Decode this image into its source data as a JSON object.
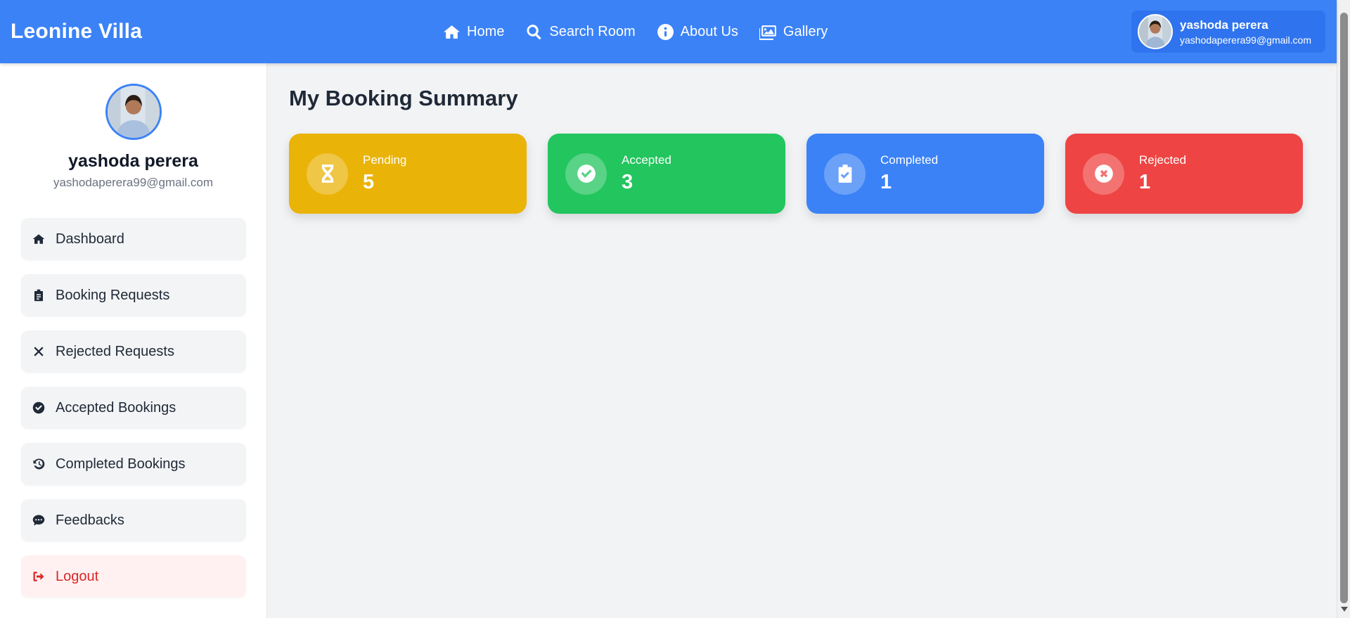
{
  "brand": "Leonine Villa",
  "nav": {
    "items": [
      {
        "label": "Home",
        "icon": "home-icon"
      },
      {
        "label": "Search Room",
        "icon": "search-icon"
      },
      {
        "label": "About Us",
        "icon": "info-icon"
      },
      {
        "label": "Gallery",
        "icon": "gallery-icon"
      }
    ]
  },
  "user": {
    "name": "yashoda perera",
    "email": "yashodaperera99@gmail.com"
  },
  "sidebar": {
    "items": [
      {
        "label": "Dashboard",
        "icon": "home-icon"
      },
      {
        "label": "Booking Requests",
        "icon": "clipboard-icon"
      },
      {
        "label": "Rejected Requests",
        "icon": "x-icon"
      },
      {
        "label": "Accepted Bookings",
        "icon": "check-circle-icon"
      },
      {
        "label": "Completed Bookings",
        "icon": "history-icon"
      },
      {
        "label": "Feedbacks",
        "icon": "comment-icon"
      },
      {
        "label": "Logout",
        "icon": "logout-icon"
      }
    ]
  },
  "main": {
    "title": "My Booking Summary",
    "cards": [
      {
        "label": "Pending",
        "value": "5",
        "color": "#eab308",
        "icon": "hourglass-icon"
      },
      {
        "label": "Accepted",
        "value": "3",
        "color": "#22c55e",
        "icon": "check-circle-icon"
      },
      {
        "label": "Completed",
        "value": "1",
        "color": "#3b82f6",
        "icon": "clipboard-check-icon"
      },
      {
        "label": "Rejected",
        "value": "1",
        "color": "#ef4444",
        "icon": "x-circle-icon"
      }
    ]
  },
  "colors": {
    "primary": "#3b82f6",
    "logout": "#dc2626"
  }
}
